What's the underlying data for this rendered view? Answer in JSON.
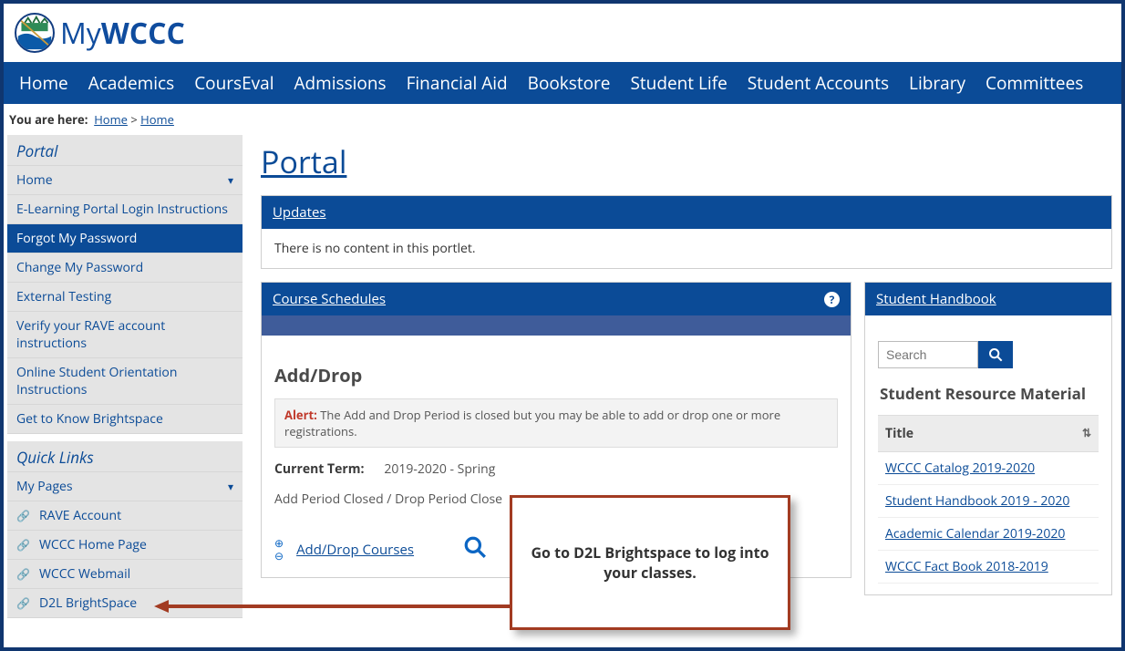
{
  "brand": {
    "prefix": "My",
    "suffix": "WCCC"
  },
  "nav": [
    "Home",
    "Academics",
    "CoursEval",
    "Admissions",
    "Financial Aid",
    "Bookstore",
    "Student Life",
    "Student Accounts",
    "Library",
    "Committees"
  ],
  "breadcrumb": {
    "label": "You are here:",
    "parts": [
      "Home",
      "Home"
    ],
    "sep": ">"
  },
  "sidebar": {
    "portal_heading": "Portal",
    "portal_items": [
      {
        "label": "Home",
        "chev": true
      },
      {
        "label": "E-Learning Portal Login Instructions"
      },
      {
        "label": "Forgot My Password",
        "active": true
      },
      {
        "label": "Change My Password"
      },
      {
        "label": "External Testing"
      },
      {
        "label": "Verify your RAVE account instructions"
      },
      {
        "label": "Online Student Orientation Instructions"
      },
      {
        "label": "Get to Know Brightspace"
      }
    ],
    "quicklinks_heading": "Quick Links",
    "quick_items": [
      {
        "label": "My Pages",
        "chev": true
      },
      {
        "label": "RAVE Account",
        "icon": true
      },
      {
        "label": "WCCC Home Page",
        "icon": true
      },
      {
        "label": "WCCC Webmail",
        "icon": true
      },
      {
        "label": "D2L BrightSpace",
        "icon": true
      }
    ]
  },
  "page_title": "Portal",
  "updates": {
    "title": "Updates",
    "body": "There is no content in this portlet."
  },
  "schedules": {
    "title": "Course Schedules",
    "section_title": "Add/Drop",
    "alert_label": "Alert:",
    "alert_text": "The Add and Drop Period is closed but you may be able to add or drop one or more registrations.",
    "term_label": "Current Term:",
    "term_value": "2019-2020 - Spring",
    "period_status": "Add Period Closed / Drop Period Close",
    "action_link": "Add/Drop Courses"
  },
  "handbook": {
    "title": "Student Handbook",
    "search_placeholder": "Search",
    "resource_heading": "Student Resource Material",
    "col_title": "Title",
    "rows": [
      "WCCC Catalog 2019-2020",
      "Student Handbook 2019 - 2020",
      "Academic Calendar 2019-2020",
      "WCCC Fact Book 2018-2019"
    ]
  },
  "callout": "Go to D2L Brightspace to log into your classes."
}
